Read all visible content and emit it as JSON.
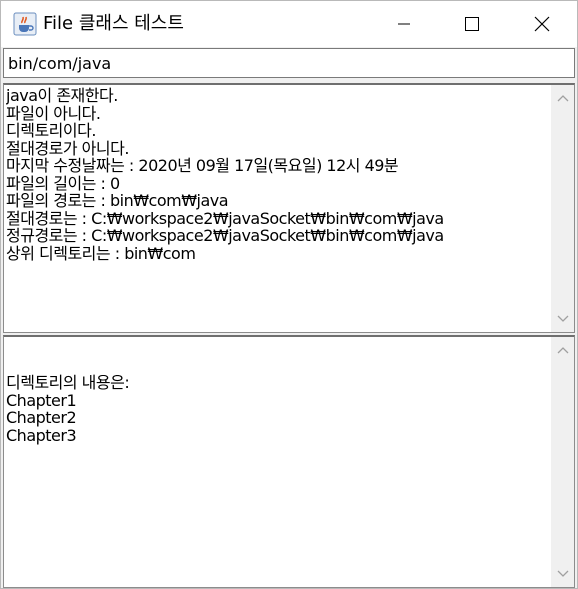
{
  "window": {
    "title": "File 클래스 테스트",
    "icon": "java-coffee-cup-icon",
    "controls": {
      "minimize_icon": "minimize-icon",
      "maximize_icon": "maximize-icon",
      "close_icon": "close-icon"
    }
  },
  "path_input": {
    "value": "bin/com/java"
  },
  "info_area": {
    "lines": [
      "java이 존재한다.",
      "파일이 아니다.",
      "디렉토리이다.",
      "절대경로가 아니다.",
      "마지막 수정날짜는 : 2020년 09월 17일(목요일) 12시 49분",
      "파일의 길이는 : 0",
      "파일의 경로는 : bin₩com₩java",
      "절대경로는 : C:₩workspace2₩javaSocket₩bin₩com₩java",
      "정규경로는 : C:₩workspace2₩javaSocket₩bin₩com₩java",
      "상위 디렉토리는 : bin₩com"
    ]
  },
  "listing_area": {
    "lines": [
      "",
      "",
      "디렉토리의 내용은:",
      "Chapter1",
      "Chapter2",
      "Chapter3"
    ]
  },
  "colors": {
    "window_bg": "#f0f0f0",
    "text_area_bg": "#ffffff",
    "scrollbar_arrow": "#a0a0a0"
  }
}
